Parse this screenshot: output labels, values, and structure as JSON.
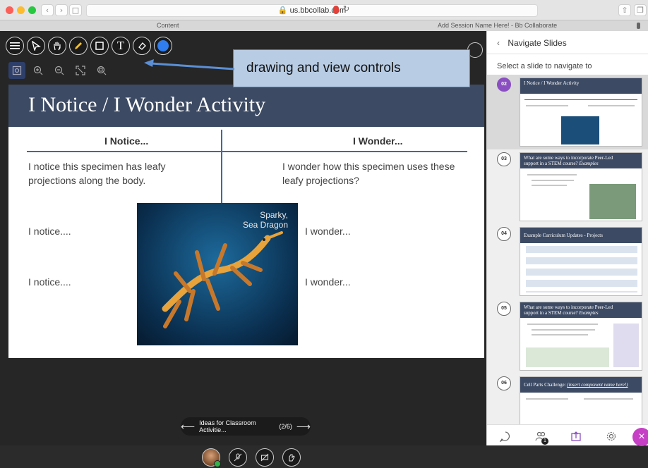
{
  "browser": {
    "url": "us.bbcollab.com",
    "tab_left": "Content",
    "tab_right": "Add Session Name Here! - Bb Collaborate"
  },
  "colors": {
    "accent": "#8b4fc2",
    "slide_header": "#3c4a64",
    "divider": "#3a6aa3",
    "callout": "#b8cce4",
    "close": "#c640c6"
  },
  "toolbar": {
    "icons": [
      "menu-icon",
      "select-arrow-icon",
      "pan-hand-icon",
      "pencil-icon",
      "rectangle-icon",
      "text-icon",
      "eraser-icon",
      "color-dot-icon"
    ],
    "view_icons": [
      "zoom-page-icon",
      "zoom-in-icon",
      "zoom-out-icon",
      "fit-icon",
      "best-fit-icon"
    ]
  },
  "callout": {
    "text": "drawing and view controls"
  },
  "slide": {
    "title": "I Notice / I Wonder Activity",
    "col_notice": "I Notice...",
    "col_wonder": "I Wonder...",
    "notice_1_line1": "I notice this specimen has leafy",
    "notice_1_line2": "projections along the body.",
    "wonder_1_line1": "I wonder how this specimen uses these",
    "wonder_1_line2": "leafy projections?",
    "notice_2": "I notice....",
    "notice_3": "I notice....",
    "wonder_2": "I wonder...",
    "wonder_3": "I wonder...",
    "photo_caption_1": "Sparky,",
    "photo_caption_2": "Sea Dragon"
  },
  "pager": {
    "label": "Ideas for Classroom Activitie...",
    "position": "(2/6)"
  },
  "panel": {
    "title": "Navigate Slides",
    "subtitle": "Select a slide to navigate to",
    "slides": [
      {
        "num": "02",
        "title": "I Notice / I Wonder Activity",
        "title2": ""
      },
      {
        "num": "03",
        "title": "What are some ways to incorporate Peer-Led",
        "title2": "support in a STEM course?",
        "title_italic": "Examples"
      },
      {
        "num": "04",
        "title": "Example Curriculum Updates - Projects",
        "title2": ""
      },
      {
        "num": "05",
        "title": "What are some ways to incorporate Peer-Led",
        "title2": "support in a STEM course?",
        "title_italic": "Examples"
      },
      {
        "num": "06",
        "title": "Cell Parts Challenge:",
        "title2": "",
        "title_italic": "(insert component name here!)"
      }
    ],
    "footer_badge": "1"
  }
}
